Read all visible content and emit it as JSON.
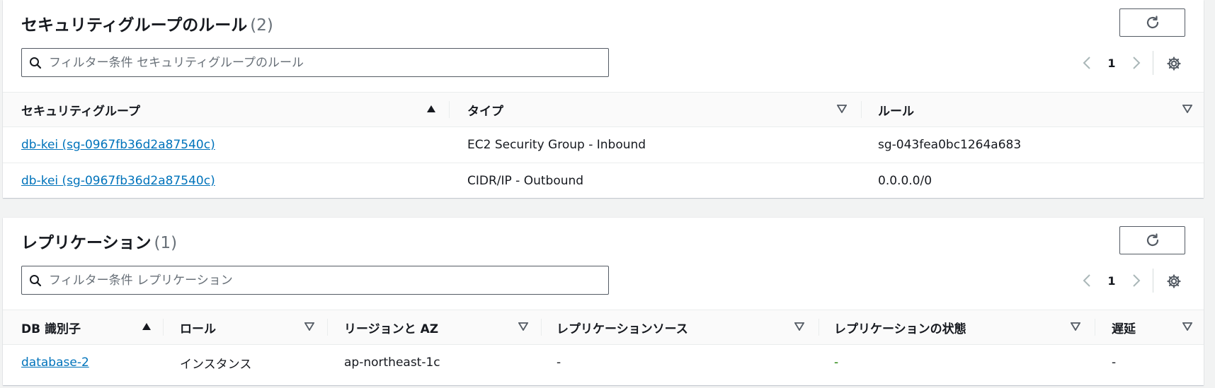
{
  "security_groups": {
    "title": "セキュリティグループのルール",
    "count": "(2)",
    "filter_placeholder": "フィルター条件 セキュリティグループのルール",
    "page": "1",
    "columns": [
      "セキュリティグループ",
      "タイプ",
      "ルール"
    ],
    "rows": [
      {
        "group": "db-kei (sg-0967fb36d2a87540c)",
        "type": "EC2 Security Group - Inbound",
        "rule": "sg-043fea0bc1264a683"
      },
      {
        "group": "db-kei (sg-0967fb36d2a87540c)",
        "type": "CIDR/IP - Outbound",
        "rule": "0.0.0.0/0"
      }
    ]
  },
  "replication": {
    "title": "レプリケーション",
    "count": "(1)",
    "filter_placeholder": "フィルター条件 レプリケーション",
    "page": "1",
    "columns": [
      "DB 識別子",
      "ロール",
      "リージョンと AZ",
      "レプリケーションソース",
      "レプリケーションの状態",
      "遅延"
    ],
    "rows": [
      {
        "db_id": "database-2",
        "role": "インスタンス",
        "region_az": "ap-northeast-1c",
        "source": "-",
        "state": "-",
        "lag": "-"
      }
    ]
  },
  "icons": {
    "refresh": "refresh-icon",
    "search": "search-icon",
    "prev": "chevron-left-icon",
    "next": "chevron-right-icon",
    "settings": "gear-icon",
    "sort_asc": "sort-ascending-icon",
    "sort_none": "sort-descending-icon"
  },
  "colors": {
    "link": "#0073bb",
    "status_green": "#1d8102",
    "background": "#f2f3f3"
  }
}
